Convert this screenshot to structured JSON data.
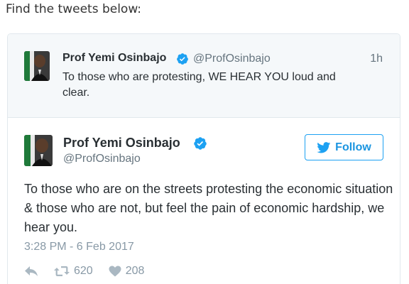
{
  "intro_text": "Find the tweets below:",
  "parent_tweet": {
    "author_name": "Prof Yemi Osinbajo",
    "handle": "@ProfOsinbajo",
    "time": "1h",
    "text": "To those who are protesting, WE HEAR YOU loud and clear."
  },
  "main_tweet": {
    "author_name": "Prof Yemi Osinbajo",
    "handle": "@ProfOsinbajo",
    "follow_label": "Follow",
    "text": "To those who are on the streets protesting the economic situation & those who are not, but feel the pain of economic hardship, we hear you.",
    "timestamp": "3:28 PM - 6 Feb 2017",
    "retweets": "620",
    "likes": "208"
  },
  "colors": {
    "accent": "#1da1f2",
    "muted": "#8899a6",
    "border": "#e1e8ed",
    "parent_bg": "#f5f8fa"
  },
  "icons": [
    "verified-badge-icon",
    "twitter-bird-icon",
    "reply-icon",
    "retweet-icon",
    "heart-icon"
  ]
}
